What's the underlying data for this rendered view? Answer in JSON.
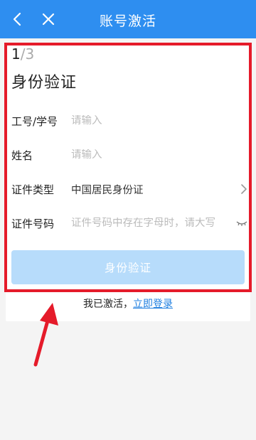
{
  "header": {
    "title": "账号激活",
    "back_icon": "chevron-left-icon",
    "close_icon": "close-icon",
    "bg_color": "#2e8ef0"
  },
  "step": {
    "current": "1",
    "total": "/3"
  },
  "heading": "身份验证",
  "form": {
    "fields": [
      {
        "label": "工号/学号",
        "placeholder": "请输入",
        "value": ""
      },
      {
        "label": "姓名",
        "placeholder": "请输入",
        "value": ""
      },
      {
        "label": "证件类型",
        "value": "中国居民身份证",
        "trail_icon": "chevron-right-icon"
      },
      {
        "label": "证件号码",
        "placeholder": "证件号码中存在字母时，请大写",
        "value": "",
        "trail_icon": "eye-closed-icon"
      }
    ]
  },
  "submit_label": "身份验证",
  "footer": {
    "text": "我已激活，",
    "link": "立即登录"
  },
  "colors": {
    "accent": "#2e8ef0",
    "button_disabled": "#b7dcfb",
    "annotation": "#e51b2a"
  }
}
